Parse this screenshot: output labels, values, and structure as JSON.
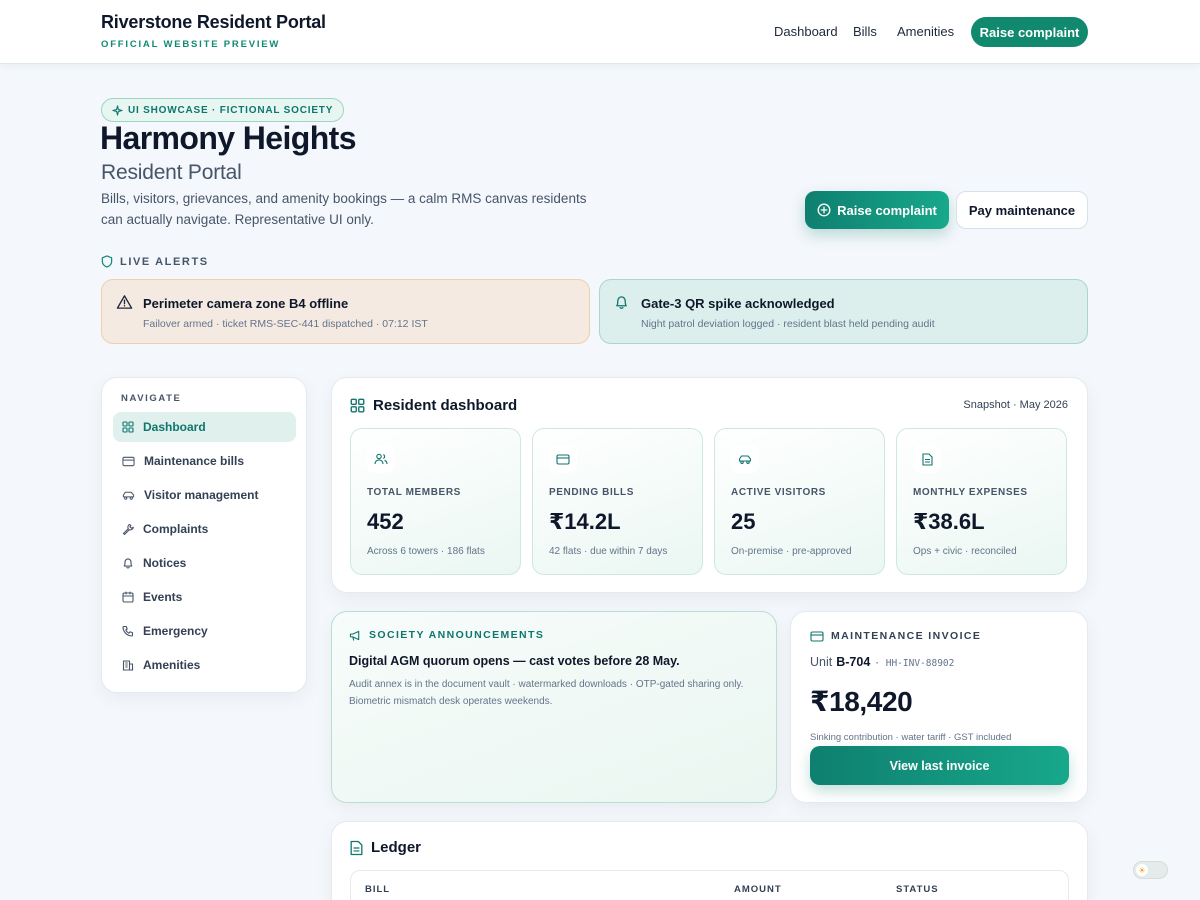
{
  "header": {
    "brand_title": "Riverstone Resident Portal",
    "brand_subtitle": "OFFICIAL WEBSITE PREVIEW",
    "nav": [
      "Dashboard",
      "Bills",
      "Amenities"
    ],
    "cta_label": "Raise complaint"
  },
  "hero": {
    "pill": "UI SHOWCASE · FICTIONAL SOCIETY",
    "title": "Harmony Heights",
    "subtitle": "Resident Portal",
    "description": "Bills, visitors, grievances, and amenity bookings — a calm RMS canvas residents can actually navigate. Representative UI only.",
    "primary_button": "Raise complaint",
    "secondary_button": "Pay maintenance"
  },
  "alerts": {
    "label": "LIVE ALERTS",
    "items": [
      {
        "title": "Perimeter camera zone B4 offline",
        "detail": "Failover armed · ticket RMS-SEC-441 dispatched · 07:12 IST",
        "tone": "warning",
        "icon": "warning-triangle-icon"
      },
      {
        "title": "Gate-3 QR spike acknowledged",
        "detail": "Night patrol deviation logged · resident blast held pending audit",
        "tone": "info",
        "icon": "bell-icon"
      }
    ]
  },
  "sidebar": {
    "label": "NAVIGATE",
    "items": [
      {
        "label": "Dashboard",
        "icon": "grid-icon",
        "active": true
      },
      {
        "label": "Maintenance bills",
        "icon": "card-icon"
      },
      {
        "label": "Visitor management",
        "icon": "car-icon"
      },
      {
        "label": "Complaints",
        "icon": "wrench-icon"
      },
      {
        "label": "Notices",
        "icon": "bell-icon"
      },
      {
        "label": "Events",
        "icon": "calendar-icon"
      },
      {
        "label": "Emergency",
        "icon": "phone-icon"
      },
      {
        "label": "Amenities",
        "icon": "building-icon"
      }
    ]
  },
  "dashboard": {
    "title": "Resident dashboard",
    "snapshot": "Snapshot · May 2026",
    "stats": [
      {
        "label": "TOTAL MEMBERS",
        "value": "452",
        "desc": "Across 6 towers · 186 flats",
        "icon": "users-icon"
      },
      {
        "label": "PENDING BILLS",
        "value": "₹14.2L",
        "desc": "42 flats · due within 7 days",
        "icon": "card-icon"
      },
      {
        "label": "ACTIVE VISITORS",
        "value": "25",
        "desc": "On-premise · pre-approved",
        "icon": "car-icon"
      },
      {
        "label": "MONTHLY EXPENSES",
        "value": "₹38.6L",
        "desc": "Ops + civic · reconciled",
        "icon": "document-icon"
      }
    ]
  },
  "announcements": {
    "label": "SOCIETY ANNOUNCEMENTS",
    "title": "Digital AGM quorum opens — cast votes before 28 May.",
    "body": "Audit annex is in the document vault · watermarked downloads · OTP-gated sharing only. Biometric mismatch desk operates weekends."
  },
  "invoice": {
    "label": "MAINTENANCE INVOICE",
    "unit_prefix": "Unit",
    "unit": "B-704",
    "code": "· HH-INV-88902",
    "amount": "₹18,420",
    "note": "Sinking contribution · water tariff · GST included",
    "button": "View last invoice"
  },
  "ledger": {
    "title": "Ledger",
    "columns": [
      "BILL",
      "AMOUNT",
      "STATUS"
    ]
  },
  "colors": {
    "accent": "#11896f",
    "warning_bg": "#f4eae2",
    "info_bg": "#dcefec"
  }
}
